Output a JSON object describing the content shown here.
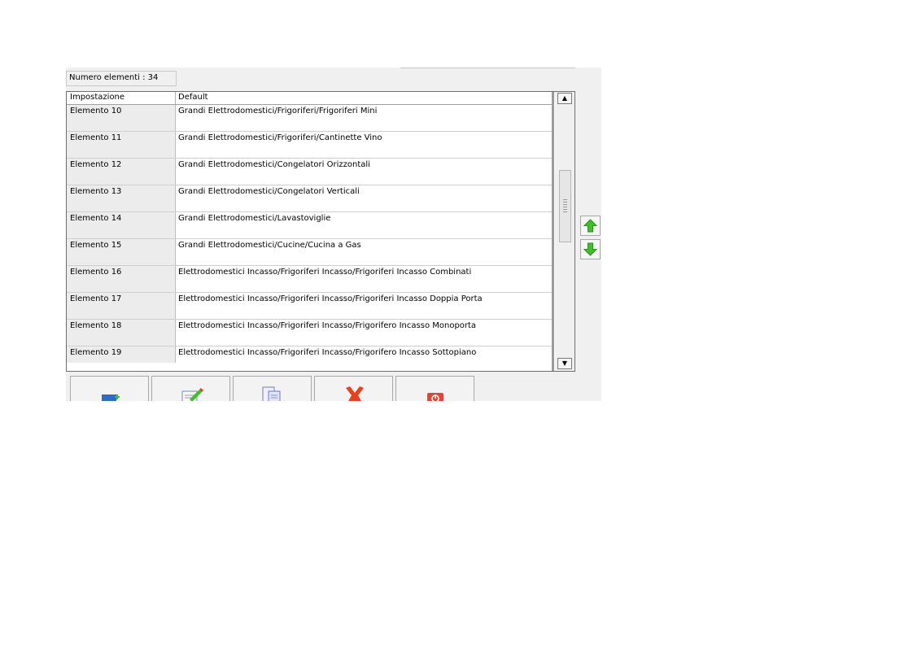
{
  "count_label": "Numero elementi : 34",
  "columns": [
    "Impostazione",
    "Default"
  ],
  "rows": [
    {
      "key": "Elemento 10",
      "value": "Grandi Elettrodomestici/Frigoriferi/Frigoriferi Mini"
    },
    {
      "key": "Elemento 11",
      "value": "Grandi Elettrodomestici/Frigoriferi/Cantinette Vino"
    },
    {
      "key": "Elemento 12",
      "value": "Grandi Elettrodomestici/Congelatori Orizzontali"
    },
    {
      "key": "Elemento 13",
      "value": "Grandi Elettrodomestici/Congelatori Verticali"
    },
    {
      "key": "Elemento 14",
      "value": "Grandi Elettrodomestici/Lavastoviglie"
    },
    {
      "key": "Elemento 15",
      "value": "Grandi Elettrodomestici/Cucine/Cucina a Gas"
    },
    {
      "key": "Elemento 16",
      "value": "Elettrodomestici Incasso/Frigoriferi Incasso/Frigoriferi Incasso Combinati"
    },
    {
      "key": "Elemento 17",
      "value": "Elettrodomestici Incasso/Frigoriferi Incasso/Frigoriferi Incasso Doppia Porta"
    },
    {
      "key": "Elemento 18",
      "value": "Elettrodomestici Incasso/Frigoriferi Incasso/Frigorifero Incasso Monoporta"
    },
    {
      "key": "Elemento 19",
      "value": "Elettrodomestici Incasso/Frigoriferi Incasso/Frigorifero Incasso Sottopiano"
    }
  ],
  "scrollbar": {
    "up_glyph": "▲",
    "down_glyph": "▼"
  },
  "side_buttons": {
    "up_icon": "green-arrow-up-icon",
    "down_icon": "green-arrow-down-icon"
  },
  "toolbar": {
    "icons": [
      "add-document-icon",
      "edit-document-icon",
      "copy-document-icon",
      "delete-x-icon",
      "power-exit-icon"
    ]
  },
  "colors": {
    "green_arrow": "#3fbf2a",
    "delete_red": "#e8401c",
    "exit_red": "#e0443a",
    "add_blue": "#2e6cc4"
  }
}
